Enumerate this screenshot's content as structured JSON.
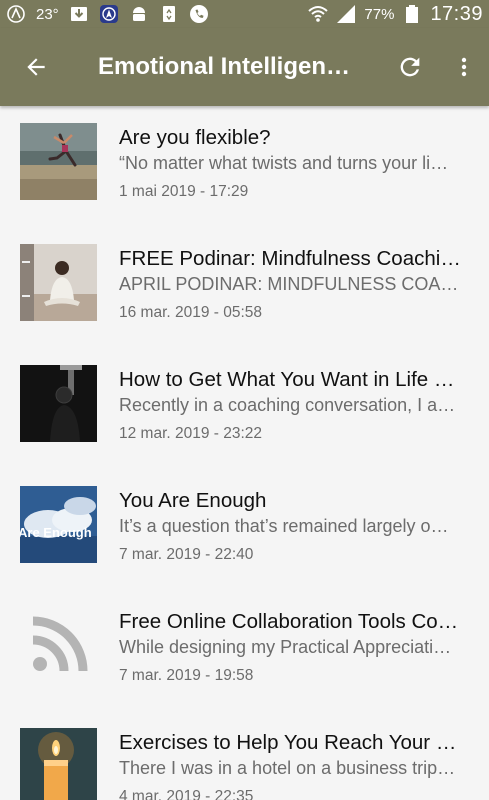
{
  "status_bar": {
    "temperature": "23°",
    "battery": "77%",
    "time": "17:39",
    "icons": [
      "app-logo-icon",
      "download-icon",
      "navigation-app-icon",
      "android-icon",
      "recycle-icon",
      "phone-icon",
      "wifi-icon",
      "signal-icon",
      "battery-icon"
    ]
  },
  "app_bar": {
    "title": "Emotional Intelligen…",
    "back_icon": "arrow-back-icon",
    "refresh_icon": "refresh-icon",
    "menu_icon": "more-vert-icon",
    "color": "#7a7a5c"
  },
  "feed": {
    "items": [
      {
        "title": "Are you flexible?",
        "excerpt": "“No matter what twists and turns your li…",
        "date": "1 mai 2019 - 17:29",
        "thumbnail": "dancer-on-beach-image"
      },
      {
        "title": "FREE Podinar: Mindfulness Coachi…",
        "excerpt": "APRIL PODINAR: MINDFULNESS COAC…",
        "date": "16 mar. 2019 - 05:58",
        "thumbnail": "meditating-person-image"
      },
      {
        "title": "How to Get What You Want in Life …",
        "excerpt": "Recently in a coaching conversation, I a…",
        "date": "12 mar. 2019 - 23:22",
        "thumbnail": "dark-silhouette-image"
      },
      {
        "title": "You Are Enough",
        "excerpt": "It’s a question that’s remained largely o…",
        "date": "7 mar. 2019 - 22:40",
        "thumbnail": "you-are-enough-clouds-image",
        "thumbnail_text": "Are Enough"
      },
      {
        "title": "Free Online Collaboration Tools Co…",
        "excerpt": "While designing my Practical Appreciati…",
        "date": "7 mar. 2019 - 19:58",
        "thumbnail": "rss-icon"
      },
      {
        "title": "Exercises to Help You Reach Your …",
        "excerpt": "There I was in a hotel on a business trip…",
        "date": "4 mar. 2019 - 22:35",
        "thumbnail": "candle-image"
      }
    ]
  }
}
